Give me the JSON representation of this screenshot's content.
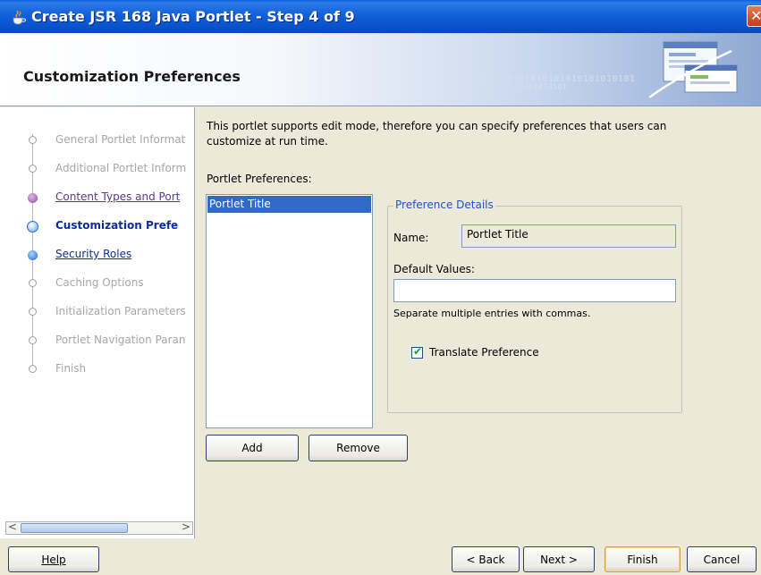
{
  "window": {
    "title": "Create JSR 168 Java Portlet - Step 4 of 9",
    "close_glyph": "✕"
  },
  "banner": {
    "heading": "Customization Preferences",
    "binary_line1": "0101010101010101010101010101",
    "binary_line2": "0101010101"
  },
  "steps": [
    {
      "label": "General Portlet Informat",
      "state": "done"
    },
    {
      "label": "Additional Portlet Inform",
      "state": "done"
    },
    {
      "label": "Content Types and Port",
      "state": "visited"
    },
    {
      "label": "Customization Prefe",
      "state": "current"
    },
    {
      "label": "Security Roles",
      "state": "next"
    },
    {
      "label": "Caching Options",
      "state": "future"
    },
    {
      "label": "Initialization Parameters",
      "state": "future"
    },
    {
      "label": "Portlet Navigation Paran",
      "state": "future"
    },
    {
      "label": "Finish",
      "state": "future"
    }
  ],
  "main": {
    "intro": "This portlet supports edit mode, therefore you can specify preferences that users can customize at run time.",
    "preferences_label": "Portlet Preferences:",
    "preferences": [
      "Portlet Title"
    ],
    "add_button": "Add",
    "remove_button": "Remove",
    "details": {
      "legend": "Preference Details",
      "name_label": "Name:",
      "name_value": "Portlet Title",
      "default_values_label": "Default Values:",
      "default_values_value": "",
      "hint": "Separate multiple entries with commas.",
      "translate_label": "Translate Preference",
      "translate_checked": true
    }
  },
  "footer": {
    "help": "Help",
    "back": "< Back",
    "next": "Next >",
    "finish": "Finish",
    "cancel": "Cancel"
  },
  "colors": {
    "titlebar": "#0b54cf",
    "selection": "#316ac5",
    "legend_text": "#1d53c8",
    "current_step": "#0a2e9b"
  }
}
